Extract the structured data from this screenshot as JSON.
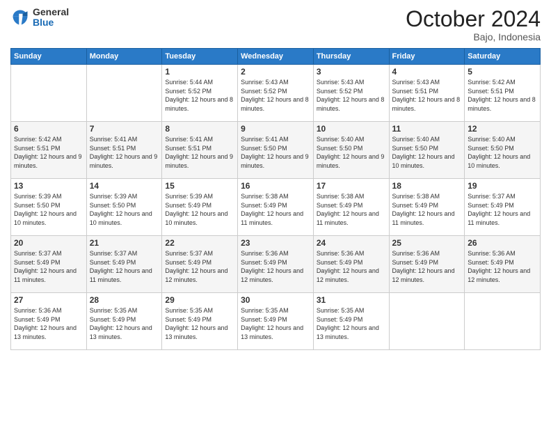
{
  "logo": {
    "general": "General",
    "blue": "Blue"
  },
  "header": {
    "month": "October 2024",
    "location": "Bajo, Indonesia"
  },
  "days_of_week": [
    "Sunday",
    "Monday",
    "Tuesday",
    "Wednesday",
    "Thursday",
    "Friday",
    "Saturday"
  ],
  "weeks": [
    [
      {
        "day": "",
        "sunrise": "",
        "sunset": "",
        "daylight": ""
      },
      {
        "day": "",
        "sunrise": "",
        "sunset": "",
        "daylight": ""
      },
      {
        "day": "1",
        "sunrise": "Sunrise: 5:44 AM",
        "sunset": "Sunset: 5:52 PM",
        "daylight": "Daylight: 12 hours and 8 minutes."
      },
      {
        "day": "2",
        "sunrise": "Sunrise: 5:43 AM",
        "sunset": "Sunset: 5:52 PM",
        "daylight": "Daylight: 12 hours and 8 minutes."
      },
      {
        "day": "3",
        "sunrise": "Sunrise: 5:43 AM",
        "sunset": "Sunset: 5:52 PM",
        "daylight": "Daylight: 12 hours and 8 minutes."
      },
      {
        "day": "4",
        "sunrise": "Sunrise: 5:43 AM",
        "sunset": "Sunset: 5:51 PM",
        "daylight": "Daylight: 12 hours and 8 minutes."
      },
      {
        "day": "5",
        "sunrise": "Sunrise: 5:42 AM",
        "sunset": "Sunset: 5:51 PM",
        "daylight": "Daylight: 12 hours and 8 minutes."
      }
    ],
    [
      {
        "day": "6",
        "sunrise": "Sunrise: 5:42 AM",
        "sunset": "Sunset: 5:51 PM",
        "daylight": "Daylight: 12 hours and 9 minutes."
      },
      {
        "day": "7",
        "sunrise": "Sunrise: 5:41 AM",
        "sunset": "Sunset: 5:51 PM",
        "daylight": "Daylight: 12 hours and 9 minutes."
      },
      {
        "day": "8",
        "sunrise": "Sunrise: 5:41 AM",
        "sunset": "Sunset: 5:51 PM",
        "daylight": "Daylight: 12 hours and 9 minutes."
      },
      {
        "day": "9",
        "sunrise": "Sunrise: 5:41 AM",
        "sunset": "Sunset: 5:50 PM",
        "daylight": "Daylight: 12 hours and 9 minutes."
      },
      {
        "day": "10",
        "sunrise": "Sunrise: 5:40 AM",
        "sunset": "Sunset: 5:50 PM",
        "daylight": "Daylight: 12 hours and 9 minutes."
      },
      {
        "day": "11",
        "sunrise": "Sunrise: 5:40 AM",
        "sunset": "Sunset: 5:50 PM",
        "daylight": "Daylight: 12 hours and 10 minutes."
      },
      {
        "day": "12",
        "sunrise": "Sunrise: 5:40 AM",
        "sunset": "Sunset: 5:50 PM",
        "daylight": "Daylight: 12 hours and 10 minutes."
      }
    ],
    [
      {
        "day": "13",
        "sunrise": "Sunrise: 5:39 AM",
        "sunset": "Sunset: 5:50 PM",
        "daylight": "Daylight: 12 hours and 10 minutes."
      },
      {
        "day": "14",
        "sunrise": "Sunrise: 5:39 AM",
        "sunset": "Sunset: 5:50 PM",
        "daylight": "Daylight: 12 hours and 10 minutes."
      },
      {
        "day": "15",
        "sunrise": "Sunrise: 5:39 AM",
        "sunset": "Sunset: 5:49 PM",
        "daylight": "Daylight: 12 hours and 10 minutes."
      },
      {
        "day": "16",
        "sunrise": "Sunrise: 5:38 AM",
        "sunset": "Sunset: 5:49 PM",
        "daylight": "Daylight: 12 hours and 11 minutes."
      },
      {
        "day": "17",
        "sunrise": "Sunrise: 5:38 AM",
        "sunset": "Sunset: 5:49 PM",
        "daylight": "Daylight: 12 hours and 11 minutes."
      },
      {
        "day": "18",
        "sunrise": "Sunrise: 5:38 AM",
        "sunset": "Sunset: 5:49 PM",
        "daylight": "Daylight: 12 hours and 11 minutes."
      },
      {
        "day": "19",
        "sunrise": "Sunrise: 5:37 AM",
        "sunset": "Sunset: 5:49 PM",
        "daylight": "Daylight: 12 hours and 11 minutes."
      }
    ],
    [
      {
        "day": "20",
        "sunrise": "Sunrise: 5:37 AM",
        "sunset": "Sunset: 5:49 PM",
        "daylight": "Daylight: 12 hours and 11 minutes."
      },
      {
        "day": "21",
        "sunrise": "Sunrise: 5:37 AM",
        "sunset": "Sunset: 5:49 PM",
        "daylight": "Daylight: 12 hours and 11 minutes."
      },
      {
        "day": "22",
        "sunrise": "Sunrise: 5:37 AM",
        "sunset": "Sunset: 5:49 PM",
        "daylight": "Daylight: 12 hours and 12 minutes."
      },
      {
        "day": "23",
        "sunrise": "Sunrise: 5:36 AM",
        "sunset": "Sunset: 5:49 PM",
        "daylight": "Daylight: 12 hours and 12 minutes."
      },
      {
        "day": "24",
        "sunrise": "Sunrise: 5:36 AM",
        "sunset": "Sunset: 5:49 PM",
        "daylight": "Daylight: 12 hours and 12 minutes."
      },
      {
        "day": "25",
        "sunrise": "Sunrise: 5:36 AM",
        "sunset": "Sunset: 5:49 PM",
        "daylight": "Daylight: 12 hours and 12 minutes."
      },
      {
        "day": "26",
        "sunrise": "Sunrise: 5:36 AM",
        "sunset": "Sunset: 5:49 PM",
        "daylight": "Daylight: 12 hours and 12 minutes."
      }
    ],
    [
      {
        "day": "27",
        "sunrise": "Sunrise: 5:36 AM",
        "sunset": "Sunset: 5:49 PM",
        "daylight": "Daylight: 12 hours and 13 minutes."
      },
      {
        "day": "28",
        "sunrise": "Sunrise: 5:35 AM",
        "sunset": "Sunset: 5:49 PM",
        "daylight": "Daylight: 12 hours and 13 minutes."
      },
      {
        "day": "29",
        "sunrise": "Sunrise: 5:35 AM",
        "sunset": "Sunset: 5:49 PM",
        "daylight": "Daylight: 12 hours and 13 minutes."
      },
      {
        "day": "30",
        "sunrise": "Sunrise: 5:35 AM",
        "sunset": "Sunset: 5:49 PM",
        "daylight": "Daylight: 12 hours and 13 minutes."
      },
      {
        "day": "31",
        "sunrise": "Sunrise: 5:35 AM",
        "sunset": "Sunset: 5:49 PM",
        "daylight": "Daylight: 12 hours and 13 minutes."
      },
      {
        "day": "",
        "sunrise": "",
        "sunset": "",
        "daylight": ""
      },
      {
        "day": "",
        "sunrise": "",
        "sunset": "",
        "daylight": ""
      }
    ]
  ]
}
